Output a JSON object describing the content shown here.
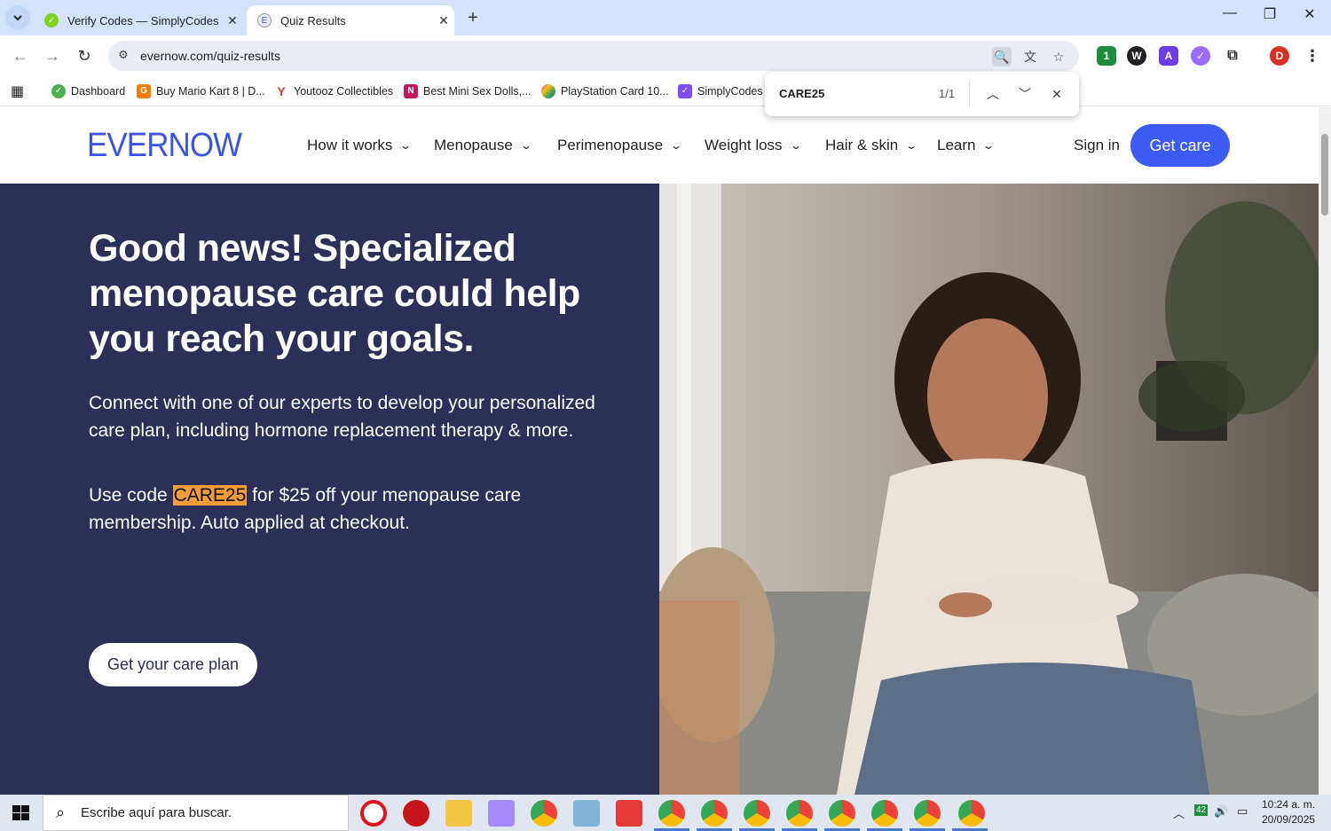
{
  "browser": {
    "tabs": [
      {
        "title": "Verify Codes — SimplyCodes",
        "active": false
      },
      {
        "title": "Quiz Results",
        "active": true
      }
    ],
    "url": "evernow.com/quiz-results",
    "bookmarks": [
      {
        "label": "Dashboard",
        "color": "#4caf50"
      },
      {
        "label": "Buy Mario Kart 8 | D...",
        "color": "#f57c00"
      },
      {
        "label": "Youtooz Collectibles",
        "color": "#e53935"
      },
      {
        "label": "Best Mini Sex Dolls,...",
        "color": "#c2185b"
      },
      {
        "label": "PlayStation Card 10...",
        "color": "#8e24aa"
      },
      {
        "label": "SimplyCodes E",
        "color": "#7c4dff"
      }
    ],
    "profile_initial": "D",
    "extension_badge": "1"
  },
  "findbar": {
    "query": "CARE25",
    "count": "1/1"
  },
  "site": {
    "logo": "EVERNOW",
    "nav": [
      "How it works",
      "Menopause",
      "Perimenopause",
      "Weight loss",
      "Hair & skin",
      "Learn"
    ],
    "sign_in": "Sign in",
    "get_care": "Get care",
    "hero": {
      "title": "Good news! Specialized menopause care could help you reach your goals.",
      "body": "Connect with one of our experts to develop your personalized care plan, including hormone replacement therapy & more.",
      "code_prefix": "Use code ",
      "code": "CARE25",
      "code_suffix": " for $25 off your menopause care membership. Auto applied at checkout.",
      "cta": "Get your care plan"
    }
  },
  "taskbar": {
    "search_placeholder": "Escribe aquí para buscar.",
    "time": "10:24 a. m.",
    "date": "20/09/2025",
    "tray_badge": "42"
  },
  "colors": {
    "hero_bg": "#2b3058",
    "brand_blue": "#3b5bf2",
    "highlight": "#f29d38"
  }
}
